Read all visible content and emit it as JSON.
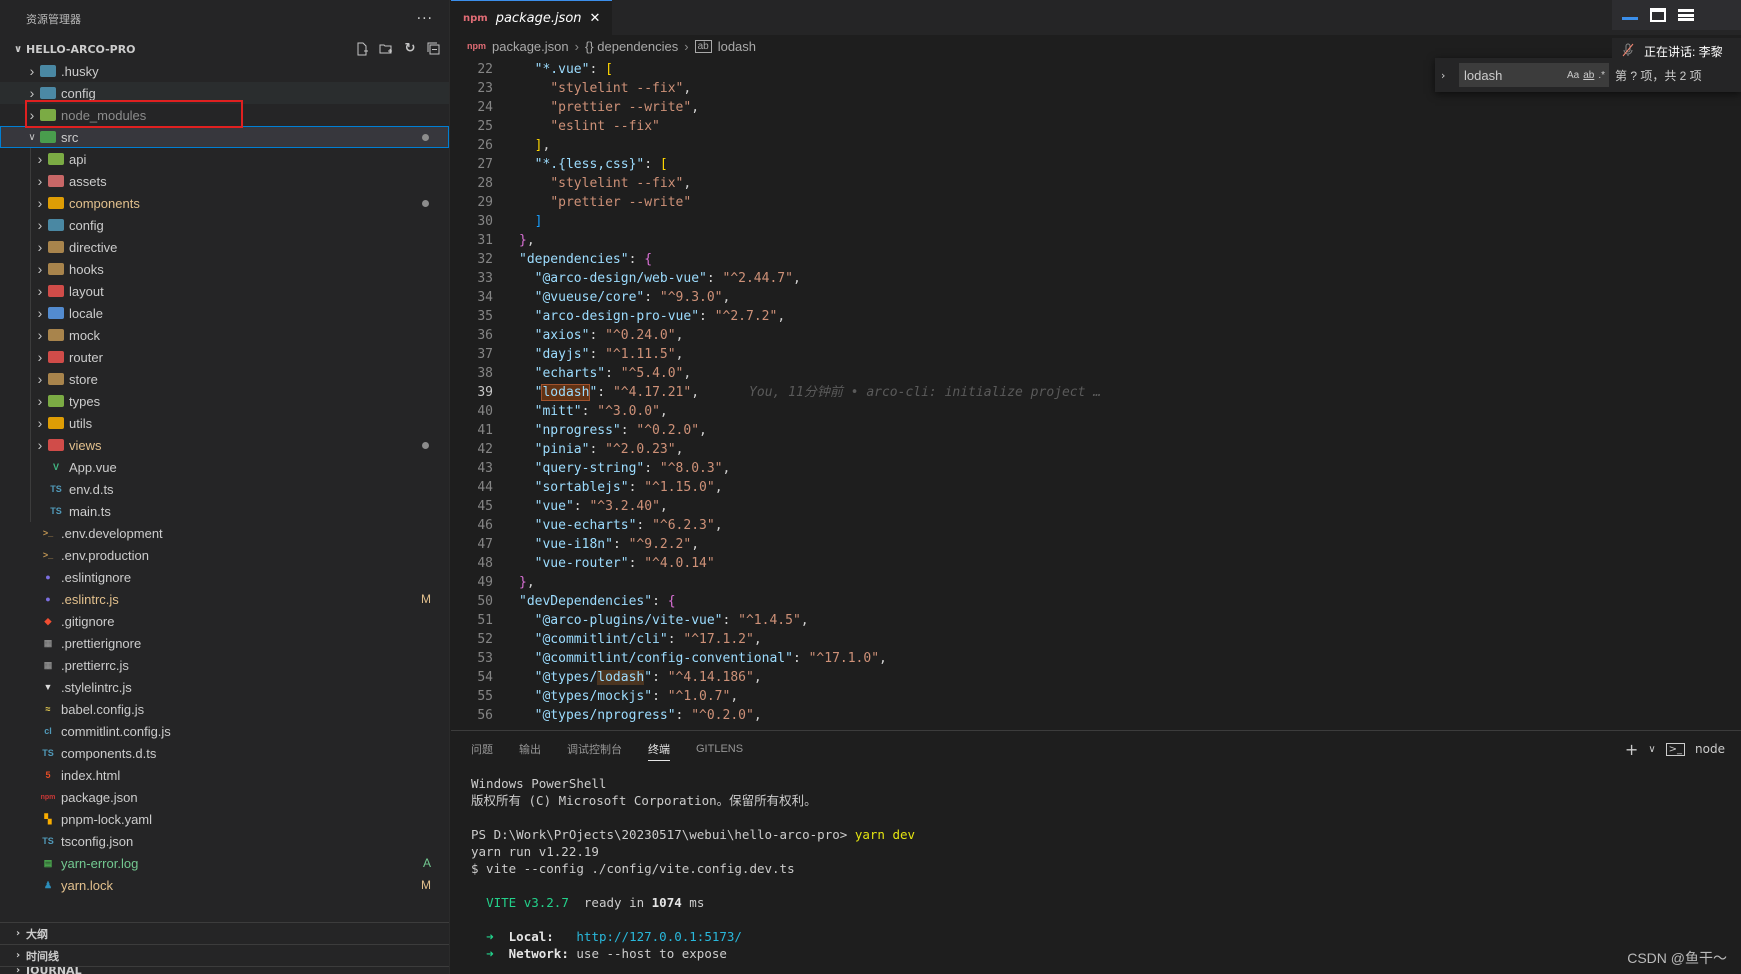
{
  "sidebar": {
    "title": "资源管理器",
    "more": "···",
    "project": "HELLO-ARCO-PRO",
    "items": [
      {
        "label": ".husky",
        "depth": 0,
        "folder": true,
        "color": "#519aba"
      },
      {
        "label": "config",
        "depth": 0,
        "folder": true,
        "color": "#519aba"
      },
      {
        "label": "node_modules",
        "depth": 0,
        "folder": true,
        "color": "#8bc34a",
        "dim": true
      },
      {
        "label": "src",
        "depth": 0,
        "folder": true,
        "open": true,
        "color": "#4caf50",
        "dot": true,
        "selected": true
      },
      {
        "label": "api",
        "depth": 1,
        "folder": true,
        "color": "#8bc34a"
      },
      {
        "label": "assets",
        "depth": 1,
        "folder": true,
        "color": "#e57373"
      },
      {
        "label": "components",
        "depth": 1,
        "folder": true,
        "color": "#ffb300",
        "dot": true,
        "mod": true
      },
      {
        "label": "config",
        "depth": 1,
        "folder": true,
        "color": "#519aba"
      },
      {
        "label": "directive",
        "depth": 1,
        "folder": true,
        "color": "#c09553"
      },
      {
        "label": "hooks",
        "depth": 1,
        "folder": true,
        "color": "#c09553"
      },
      {
        "label": "layout",
        "depth": 1,
        "folder": true,
        "color": "#ef5350"
      },
      {
        "label": "locale",
        "depth": 1,
        "folder": true,
        "color": "#5c9ded"
      },
      {
        "label": "mock",
        "depth": 1,
        "folder": true,
        "color": "#c09553"
      },
      {
        "label": "router",
        "depth": 1,
        "folder": true,
        "color": "#ef5350"
      },
      {
        "label": "store",
        "depth": 1,
        "folder": true,
        "color": "#c09553"
      },
      {
        "label": "types",
        "depth": 1,
        "folder": true,
        "color": "#8bc34a"
      },
      {
        "label": "utils",
        "depth": 1,
        "folder": true,
        "color": "#ffb300"
      },
      {
        "label": "views",
        "depth": 1,
        "folder": true,
        "color": "#ef5350",
        "dot": true,
        "mod": true
      },
      {
        "label": "App.vue",
        "depth": 1,
        "icon": "V",
        "color": "#41b883"
      },
      {
        "label": "env.d.ts",
        "depth": 1,
        "icon": "TS",
        "color": "#519aba"
      },
      {
        "label": "main.ts",
        "depth": 1,
        "icon": "TS",
        "color": "#519aba"
      },
      {
        "label": ".env.development",
        "depth": 0,
        "icon": ">_",
        "color": "#c09553"
      },
      {
        "label": ".env.production",
        "depth": 0,
        "icon": ">_",
        "color": "#c09553"
      },
      {
        "label": ".eslintignore",
        "depth": 0,
        "icon": "●",
        "color": "#7c6fe0"
      },
      {
        "label": ".eslintrc.js",
        "depth": 0,
        "icon": "●",
        "color": "#7c6fe0",
        "badge": "M",
        "mod": true
      },
      {
        "label": ".gitignore",
        "depth": 0,
        "icon": "◆",
        "color": "#f14e32"
      },
      {
        "label": ".prettierignore",
        "depth": 0,
        "icon": "▦",
        "color": "#8a8a8a"
      },
      {
        "label": ".prettierrc.js",
        "depth": 0,
        "icon": "▦",
        "color": "#8a8a8a"
      },
      {
        "label": ".stylelintrc.js",
        "depth": 0,
        "icon": "▼",
        "color": "#dddddd"
      },
      {
        "label": "babel.config.js",
        "depth": 0,
        "icon": "≈",
        "color": "#f5da55"
      },
      {
        "label": "commitlint.config.js",
        "depth": 0,
        "icon": "cl",
        "color": "#519aba"
      },
      {
        "label": "components.d.ts",
        "depth": 0,
        "icon": "TS",
        "color": "#519aba"
      },
      {
        "label": "index.html",
        "depth": 0,
        "icon": "5",
        "color": "#e44d26"
      },
      {
        "label": "package.json",
        "depth": 0,
        "icon": "npm",
        "color": "#cb3837"
      },
      {
        "label": "pnpm-lock.yaml",
        "depth": 0,
        "icon": "▚",
        "color": "#f9ad00"
      },
      {
        "label": "tsconfig.json",
        "depth": 0,
        "icon": "TS",
        "color": "#519aba"
      },
      {
        "label": "yarn-error.log",
        "depth": 0,
        "icon": "▤",
        "color": "#4caf50",
        "badge": "A",
        "add": true
      },
      {
        "label": "yarn.lock",
        "depth": 0,
        "icon": "♟",
        "color": "#2c8ebb",
        "badge": "M",
        "mod": true
      }
    ],
    "bottom": [
      "大纲",
      "时间线",
      "JOURNAL"
    ]
  },
  "editor": {
    "tab": {
      "icon": "npm",
      "label": "package.json",
      "close": "✕"
    },
    "breadcrumb": {
      "file": "package.json",
      "section": "{} dependencies",
      "leaf": "lodash",
      "sep": "›"
    },
    "blame": "You, 11分钟前 • arco-cli: initialize project …"
  },
  "find": {
    "query": "lodash",
    "opt1": "Aa",
    "opt2": "ab",
    "opt3": ".*",
    "result": "第 ? 项，共 2 项"
  },
  "overlay": {
    "speaking": "正在讲话: 李黎"
  },
  "panel": {
    "tabs": [
      "问题",
      "输出",
      "调试控制台",
      "终端",
      "GITLENS"
    ],
    "active_tab": 3,
    "terminal_name": "node",
    "lines": {
      "l1": "Windows PowerShell",
      "l2": "版权所有 (C) Microsoft Corporation。保留所有权利。",
      "prompt": "PS D:\\Work\\PrOjects\\20230517\\webui\\hello-arco-pro> ",
      "cmd": "yarn dev",
      "l4": "yarn run v1.22.19",
      "l5": "$ vite --config ./config/vite.config.dev.ts",
      "vite": "VITE v3.2.7",
      "ready": "  ready in ",
      "ms": "1074",
      "ms_unit": " ms",
      "arrow": "➜",
      "local_label": "Local:",
      "local_url": "http://127.0.0.1:5173/",
      "network_label": "Network:",
      "network_text": " use --host to expose"
    }
  },
  "watermark": "CSDN @鱼干～"
}
